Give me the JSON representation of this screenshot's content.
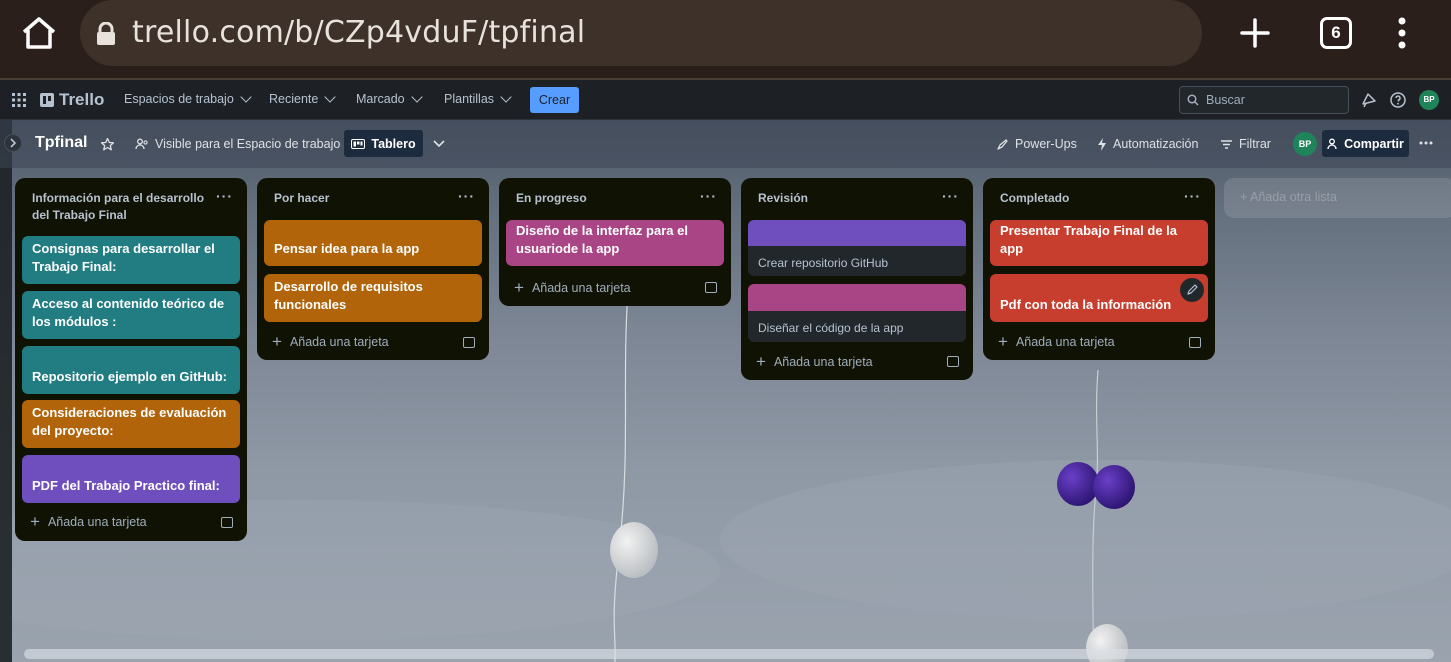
{
  "browser": {
    "url": "trello.com/b/CZp4vduF/tpfinal",
    "tab_count": "6"
  },
  "header": {
    "logo": "Trello",
    "nav": [
      "Espacios de trabajo",
      "Reciente",
      "Marcado",
      "Plantillas"
    ],
    "create": "Crear",
    "search_placeholder": "Buscar",
    "avatar": "BP"
  },
  "board": {
    "title": "Tpfinal",
    "visibility": "Visible para el Espacio de trabajo",
    "view": "Tablero",
    "powerups": "Power-Ups",
    "automation": "Automatización",
    "filter": "Filtrar",
    "avatar": "BP",
    "share": "Compartir",
    "add_list": "Añada otra lista",
    "add_card": "Añada una tarjeta"
  },
  "lists": [
    {
      "title": "Información para el desarrollo del Trabajo Final",
      "cards": [
        {
          "text": "Consignas para desarrollar el Trabajo Final:",
          "color": "#227d82"
        },
        {
          "text": "Acceso al contenido teórico de los módulos :",
          "color": "#227d82"
        },
        {
          "text": "Repositorio ejemplo en GitHub:",
          "color": "#227d82"
        },
        {
          "text": "Consideraciones de evaluación del proyecto:",
          "color": "#b1640a"
        },
        {
          "text": "PDF del Trabajo Practico final:",
          "color": "#6e4fbd"
        }
      ]
    },
    {
      "title": "Por hacer",
      "cards": [
        {
          "text": "Pensar idea para la app",
          "color": "#b1640a"
        },
        {
          "text": "Desarrollo de requisitos funcionales",
          "color": "#b1640a"
        }
      ]
    },
    {
      "title": "En progreso",
      "cards": [
        {
          "text": "Diseño de la interfaz para el usuariode la app",
          "color": "#a94585"
        }
      ]
    },
    {
      "title": "Revisión",
      "cards": [
        {
          "text": "Crear repositorio GitHub",
          "cover": "#6e4fbd"
        },
        {
          "text": "Diseñar el código de la app",
          "cover": "#a94585"
        }
      ]
    },
    {
      "title": "Completado",
      "cards": [
        {
          "text": "Presentar Trabajo Final de la app",
          "color": "#c73e2e"
        },
        {
          "text": "Pdf con toda la información",
          "color": "#c73e2e"
        }
      ]
    }
  ]
}
